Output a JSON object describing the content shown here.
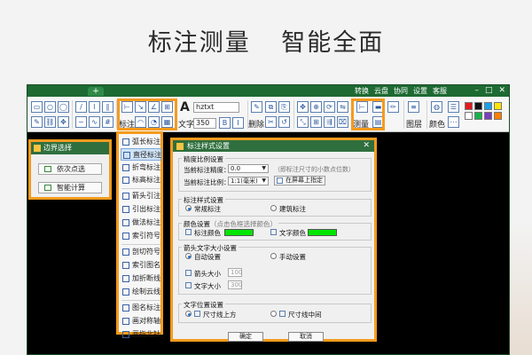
{
  "headline": {
    "left": "标注测量",
    "right": "智能全面"
  },
  "titlebar": {
    "links": [
      "转换",
      "云盘",
      "协同",
      "设置",
      "客服"
    ],
    "window_controls": [
      "–",
      "□",
      "✕"
    ],
    "new_tab_icon": "plus-icon"
  },
  "toolbar": {
    "annotate_label": "标注",
    "text_label": "文字",
    "font_name": "hztxt",
    "font_size": "350",
    "delete_label": "删除",
    "measure_label": "测量",
    "layer_label": "图层",
    "color_label": "颜色",
    "swatch_colors": [
      "#e31b1b",
      "#111111",
      "#1aa1e8",
      "#ffe600",
      "#ffffff",
      "#17b34a",
      "#7b3fc0",
      "#ff7f00"
    ]
  },
  "boundary_panel": {
    "title": "边界选择",
    "buttons": [
      "依次点选",
      "智能计算"
    ]
  },
  "annotate_menu": {
    "items": [
      "弧长标注",
      "直径标注",
      "折弯标注",
      "标高标注",
      "箭头引注",
      "引出标注",
      "做法标注",
      "索引符号",
      "剖切符号",
      "索引图名",
      "加折断线",
      "绘制云线",
      "图名标注",
      "画对称轴",
      "画指北针"
    ],
    "selected_index": 1
  },
  "dialog": {
    "title": "标注样式设置",
    "close": "✕",
    "precision_group": {
      "title": "精度比例设置",
      "precision_label": "当前标注精度：",
      "precision_value": "0.0",
      "precision_hint": "（即标注尺寸的小数点位数）",
      "scale_label": "当前标注比例：",
      "scale_value": "1:1(毫米)",
      "screen_button": "在屏幕上指定"
    },
    "style_group": {
      "title": "标注样式设置",
      "option_normal": "常规标注",
      "option_arch": "建筑标注"
    },
    "color_group": {
      "title": "颜色设置",
      "hint": "（点击色框选择颜色）",
      "dim_color_label": "标注颜色",
      "text_color_label": "文字颜色",
      "dim_color": "#00e600",
      "text_color": "#00e600"
    },
    "size_group": {
      "title": "箭头文字大小设置",
      "auto": "自动设置",
      "manual": "手动设置",
      "arrow_label": "箭头大小",
      "arrow_value": "100",
      "text_label": "文字大小",
      "text_value": "300"
    },
    "position_group": {
      "title": "文字位置设置",
      "above": "尺寸线上方",
      "middle": "尺寸线中间"
    },
    "ok": "确定",
    "cancel": "取消"
  }
}
